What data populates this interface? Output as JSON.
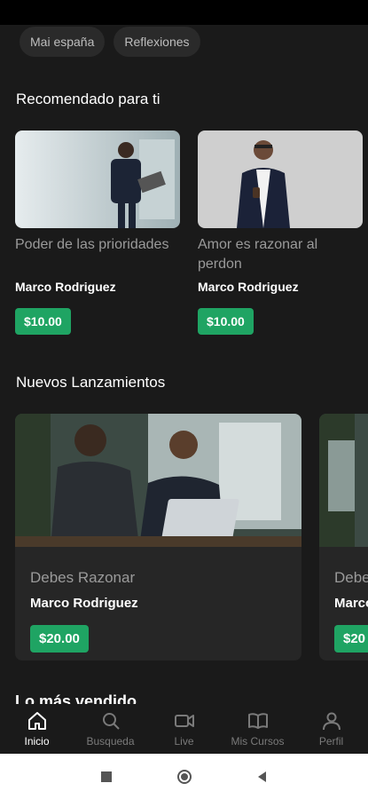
{
  "chips": [
    "Mai españa",
    "Reflexiones"
  ],
  "recommended": {
    "title": "Recomendado para ti",
    "items": [
      {
        "title": "Poder de las prioridades",
        "author": "Marco Rodriguez",
        "price": "$10.00"
      },
      {
        "title": "Amor es razonar al perdon",
        "author": "Marco Rodriguez",
        "price": "$10.00"
      }
    ]
  },
  "new_releases": {
    "title": "Nuevos Lanzamientos",
    "items": [
      {
        "title": "Debes Razonar",
        "author": "Marco Rodriguez",
        "price": "$20.00"
      },
      {
        "title": "Debe",
        "author": "Marco",
        "price": "$20"
      }
    ]
  },
  "best_sellers_title": "Lo más vendido",
  "nav": {
    "home": "Inicio",
    "search": "Busqueda",
    "live": "Live",
    "courses": "Mis Cursos",
    "profile": "Perfil"
  },
  "colors": {
    "accent": "#1fa463",
    "background": "#1a1a1a",
    "card": "#262626"
  }
}
